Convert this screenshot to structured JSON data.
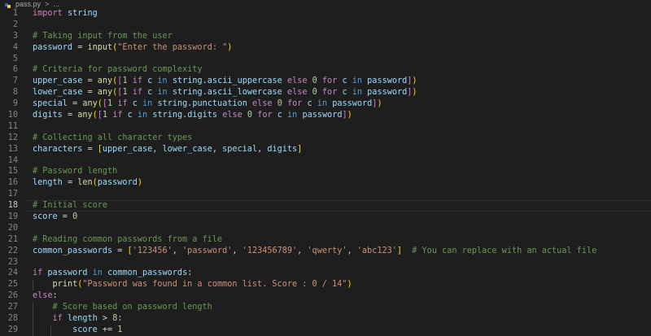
{
  "breadcrumb": {
    "file": "pass.py",
    "separator": ">",
    "more": "..."
  },
  "lines": [
    {
      "n": "1",
      "tokens": [
        [
          "kw",
          "import"
        ],
        [
          "pl",
          " "
        ],
        [
          "var",
          "string"
        ]
      ]
    },
    {
      "n": "2",
      "tokens": []
    },
    {
      "n": "3",
      "tokens": [
        [
          "cm",
          "# Taking input from the user"
        ]
      ]
    },
    {
      "n": "4",
      "tokens": [
        [
          "var",
          "password"
        ],
        [
          "pl",
          " = "
        ],
        [
          "fn",
          "input"
        ],
        [
          "b1",
          "("
        ],
        [
          "str",
          "\"Enter the password: \""
        ],
        [
          "b1",
          ")"
        ]
      ]
    },
    {
      "n": "5",
      "tokens": []
    },
    {
      "n": "6",
      "tokens": [
        [
          "cm",
          "# Criteria for password complexity"
        ]
      ]
    },
    {
      "n": "7",
      "tokens": [
        [
          "var",
          "upper_case"
        ],
        [
          "pl",
          " = "
        ],
        [
          "fn",
          "any"
        ],
        [
          "b1",
          "("
        ],
        [
          "b2",
          "["
        ],
        [
          "num",
          "1"
        ],
        [
          "pl",
          " "
        ],
        [
          "kw",
          "if"
        ],
        [
          "pl",
          " "
        ],
        [
          "var",
          "c"
        ],
        [
          "pl",
          " "
        ],
        [
          "kb",
          "in"
        ],
        [
          "pl",
          " "
        ],
        [
          "var",
          "string"
        ],
        [
          "pl",
          "."
        ],
        [
          "var",
          "ascii_uppercase"
        ],
        [
          "pl",
          " "
        ],
        [
          "kw",
          "else"
        ],
        [
          "pl",
          " "
        ],
        [
          "num",
          "0"
        ],
        [
          "pl",
          " "
        ],
        [
          "kw",
          "for"
        ],
        [
          "pl",
          " "
        ],
        [
          "var",
          "c"
        ],
        [
          "pl",
          " "
        ],
        [
          "kb",
          "in"
        ],
        [
          "pl",
          " "
        ],
        [
          "var",
          "password"
        ],
        [
          "b2",
          "]"
        ],
        [
          "b1",
          ")"
        ]
      ]
    },
    {
      "n": "8",
      "tokens": [
        [
          "var",
          "lower_case"
        ],
        [
          "pl",
          " = "
        ],
        [
          "fn",
          "any"
        ],
        [
          "b1",
          "("
        ],
        [
          "b2",
          "["
        ],
        [
          "num",
          "1"
        ],
        [
          "pl",
          " "
        ],
        [
          "kw",
          "if"
        ],
        [
          "pl",
          " "
        ],
        [
          "var",
          "c"
        ],
        [
          "pl",
          " "
        ],
        [
          "kb",
          "in"
        ],
        [
          "pl",
          " "
        ],
        [
          "var",
          "string"
        ],
        [
          "pl",
          "."
        ],
        [
          "var",
          "ascii_lowercase"
        ],
        [
          "pl",
          " "
        ],
        [
          "kw",
          "else"
        ],
        [
          "pl",
          " "
        ],
        [
          "num",
          "0"
        ],
        [
          "pl",
          " "
        ],
        [
          "kw",
          "for"
        ],
        [
          "pl",
          " "
        ],
        [
          "var",
          "c"
        ],
        [
          "pl",
          " "
        ],
        [
          "kb",
          "in"
        ],
        [
          "pl",
          " "
        ],
        [
          "var",
          "password"
        ],
        [
          "b2",
          "]"
        ],
        [
          "b1",
          ")"
        ]
      ]
    },
    {
      "n": "9",
      "tokens": [
        [
          "var",
          "special"
        ],
        [
          "pl",
          " = "
        ],
        [
          "fn",
          "any"
        ],
        [
          "b1",
          "("
        ],
        [
          "b2",
          "["
        ],
        [
          "num",
          "1"
        ],
        [
          "pl",
          " "
        ],
        [
          "kw",
          "if"
        ],
        [
          "pl",
          " "
        ],
        [
          "var",
          "c"
        ],
        [
          "pl",
          " "
        ],
        [
          "kb",
          "in"
        ],
        [
          "pl",
          " "
        ],
        [
          "var",
          "string"
        ],
        [
          "pl",
          "."
        ],
        [
          "var",
          "punctuation"
        ],
        [
          "pl",
          " "
        ],
        [
          "kw",
          "else"
        ],
        [
          "pl",
          " "
        ],
        [
          "num",
          "0"
        ],
        [
          "pl",
          " "
        ],
        [
          "kw",
          "for"
        ],
        [
          "pl",
          " "
        ],
        [
          "var",
          "c"
        ],
        [
          "pl",
          " "
        ],
        [
          "kb",
          "in"
        ],
        [
          "pl",
          " "
        ],
        [
          "var",
          "password"
        ],
        [
          "b2",
          "]"
        ],
        [
          "b1",
          ")"
        ]
      ]
    },
    {
      "n": "10",
      "tokens": [
        [
          "var",
          "digits"
        ],
        [
          "pl",
          " = "
        ],
        [
          "fn",
          "any"
        ],
        [
          "b1",
          "("
        ],
        [
          "b2",
          "["
        ],
        [
          "num",
          "1"
        ],
        [
          "pl",
          " "
        ],
        [
          "kw",
          "if"
        ],
        [
          "pl",
          " "
        ],
        [
          "var",
          "c"
        ],
        [
          "pl",
          " "
        ],
        [
          "kb",
          "in"
        ],
        [
          "pl",
          " "
        ],
        [
          "var",
          "string"
        ],
        [
          "pl",
          "."
        ],
        [
          "var",
          "digits"
        ],
        [
          "pl",
          " "
        ],
        [
          "kw",
          "else"
        ],
        [
          "pl",
          " "
        ],
        [
          "num",
          "0"
        ],
        [
          "pl",
          " "
        ],
        [
          "kw",
          "for"
        ],
        [
          "pl",
          " "
        ],
        [
          "var",
          "c"
        ],
        [
          "pl",
          " "
        ],
        [
          "kb",
          "in"
        ],
        [
          "pl",
          " "
        ],
        [
          "var",
          "password"
        ],
        [
          "b2",
          "]"
        ],
        [
          "b1",
          ")"
        ]
      ]
    },
    {
      "n": "11",
      "tokens": []
    },
    {
      "n": "12",
      "tokens": [
        [
          "cm",
          "# Collecting all character types"
        ]
      ]
    },
    {
      "n": "13",
      "tokens": [
        [
          "var",
          "characters"
        ],
        [
          "pl",
          " = "
        ],
        [
          "b1",
          "["
        ],
        [
          "var",
          "upper_case"
        ],
        [
          "pl",
          ", "
        ],
        [
          "var",
          "lower_case"
        ],
        [
          "pl",
          ", "
        ],
        [
          "var",
          "special"
        ],
        [
          "pl",
          ", "
        ],
        [
          "var",
          "digits"
        ],
        [
          "b1",
          "]"
        ]
      ]
    },
    {
      "n": "14",
      "tokens": []
    },
    {
      "n": "15",
      "tokens": [
        [
          "cm",
          "# Password length"
        ]
      ]
    },
    {
      "n": "16",
      "tokens": [
        [
          "var",
          "length"
        ],
        [
          "pl",
          " = "
        ],
        [
          "fn",
          "len"
        ],
        [
          "b1",
          "("
        ],
        [
          "var",
          "password"
        ],
        [
          "b1",
          ")"
        ]
      ]
    },
    {
      "n": "17",
      "tokens": []
    },
    {
      "n": "18",
      "tokens": [
        [
          "cm",
          "# Initial score"
        ]
      ],
      "current": true
    },
    {
      "n": "19",
      "tokens": [
        [
          "var",
          "score"
        ],
        [
          "pl",
          " = "
        ],
        [
          "num",
          "0"
        ]
      ]
    },
    {
      "n": "20",
      "tokens": []
    },
    {
      "n": "21",
      "tokens": [
        [
          "cm",
          "# Reading common passwords from a file"
        ]
      ]
    },
    {
      "n": "22",
      "tokens": [
        [
          "var",
          "common_passwords"
        ],
        [
          "pl",
          " = "
        ],
        [
          "b1",
          "["
        ],
        [
          "str",
          "'123456'"
        ],
        [
          "pl",
          ", "
        ],
        [
          "str",
          "'password'"
        ],
        [
          "pl",
          ", "
        ],
        [
          "str",
          "'123456789'"
        ],
        [
          "pl",
          ", "
        ],
        [
          "str",
          "'qwerty'"
        ],
        [
          "pl",
          ", "
        ],
        [
          "str",
          "'abc123'"
        ],
        [
          "b1",
          "]"
        ],
        [
          "pl",
          "  "
        ],
        [
          "cm",
          "# You can replace with an actual file"
        ]
      ]
    },
    {
      "n": "23",
      "tokens": []
    },
    {
      "n": "24",
      "tokens": [
        [
          "kw",
          "if"
        ],
        [
          "pl",
          " "
        ],
        [
          "var",
          "password"
        ],
        [
          "pl",
          " "
        ],
        [
          "kb",
          "in"
        ],
        [
          "pl",
          " "
        ],
        [
          "var",
          "common_passwords"
        ],
        [
          "pl",
          ":"
        ]
      ]
    },
    {
      "n": "25",
      "tokens": [
        [
          "pl",
          "    "
        ],
        [
          "fn",
          "print"
        ],
        [
          "b1",
          "("
        ],
        [
          "str",
          "\"Password was found in a common list. Score : 0 / 14\""
        ],
        [
          "b1",
          ")"
        ]
      ]
    },
    {
      "n": "26",
      "tokens": [
        [
          "kw",
          "else"
        ],
        [
          "pl",
          ":"
        ]
      ]
    },
    {
      "n": "27",
      "tokens": [
        [
          "pl",
          "    "
        ],
        [
          "cm",
          "# Score based on password length"
        ]
      ]
    },
    {
      "n": "28",
      "tokens": [
        [
          "pl",
          "    "
        ],
        [
          "kw",
          "if"
        ],
        [
          "pl",
          " "
        ],
        [
          "var",
          "length"
        ],
        [
          "pl",
          " > "
        ],
        [
          "num",
          "8"
        ],
        [
          "pl",
          ":"
        ]
      ]
    },
    {
      "n": "29",
      "tokens": [
        [
          "pl",
          "        "
        ],
        [
          "var",
          "score"
        ],
        [
          "pl",
          " += "
        ],
        [
          "num",
          "1"
        ]
      ]
    }
  ]
}
